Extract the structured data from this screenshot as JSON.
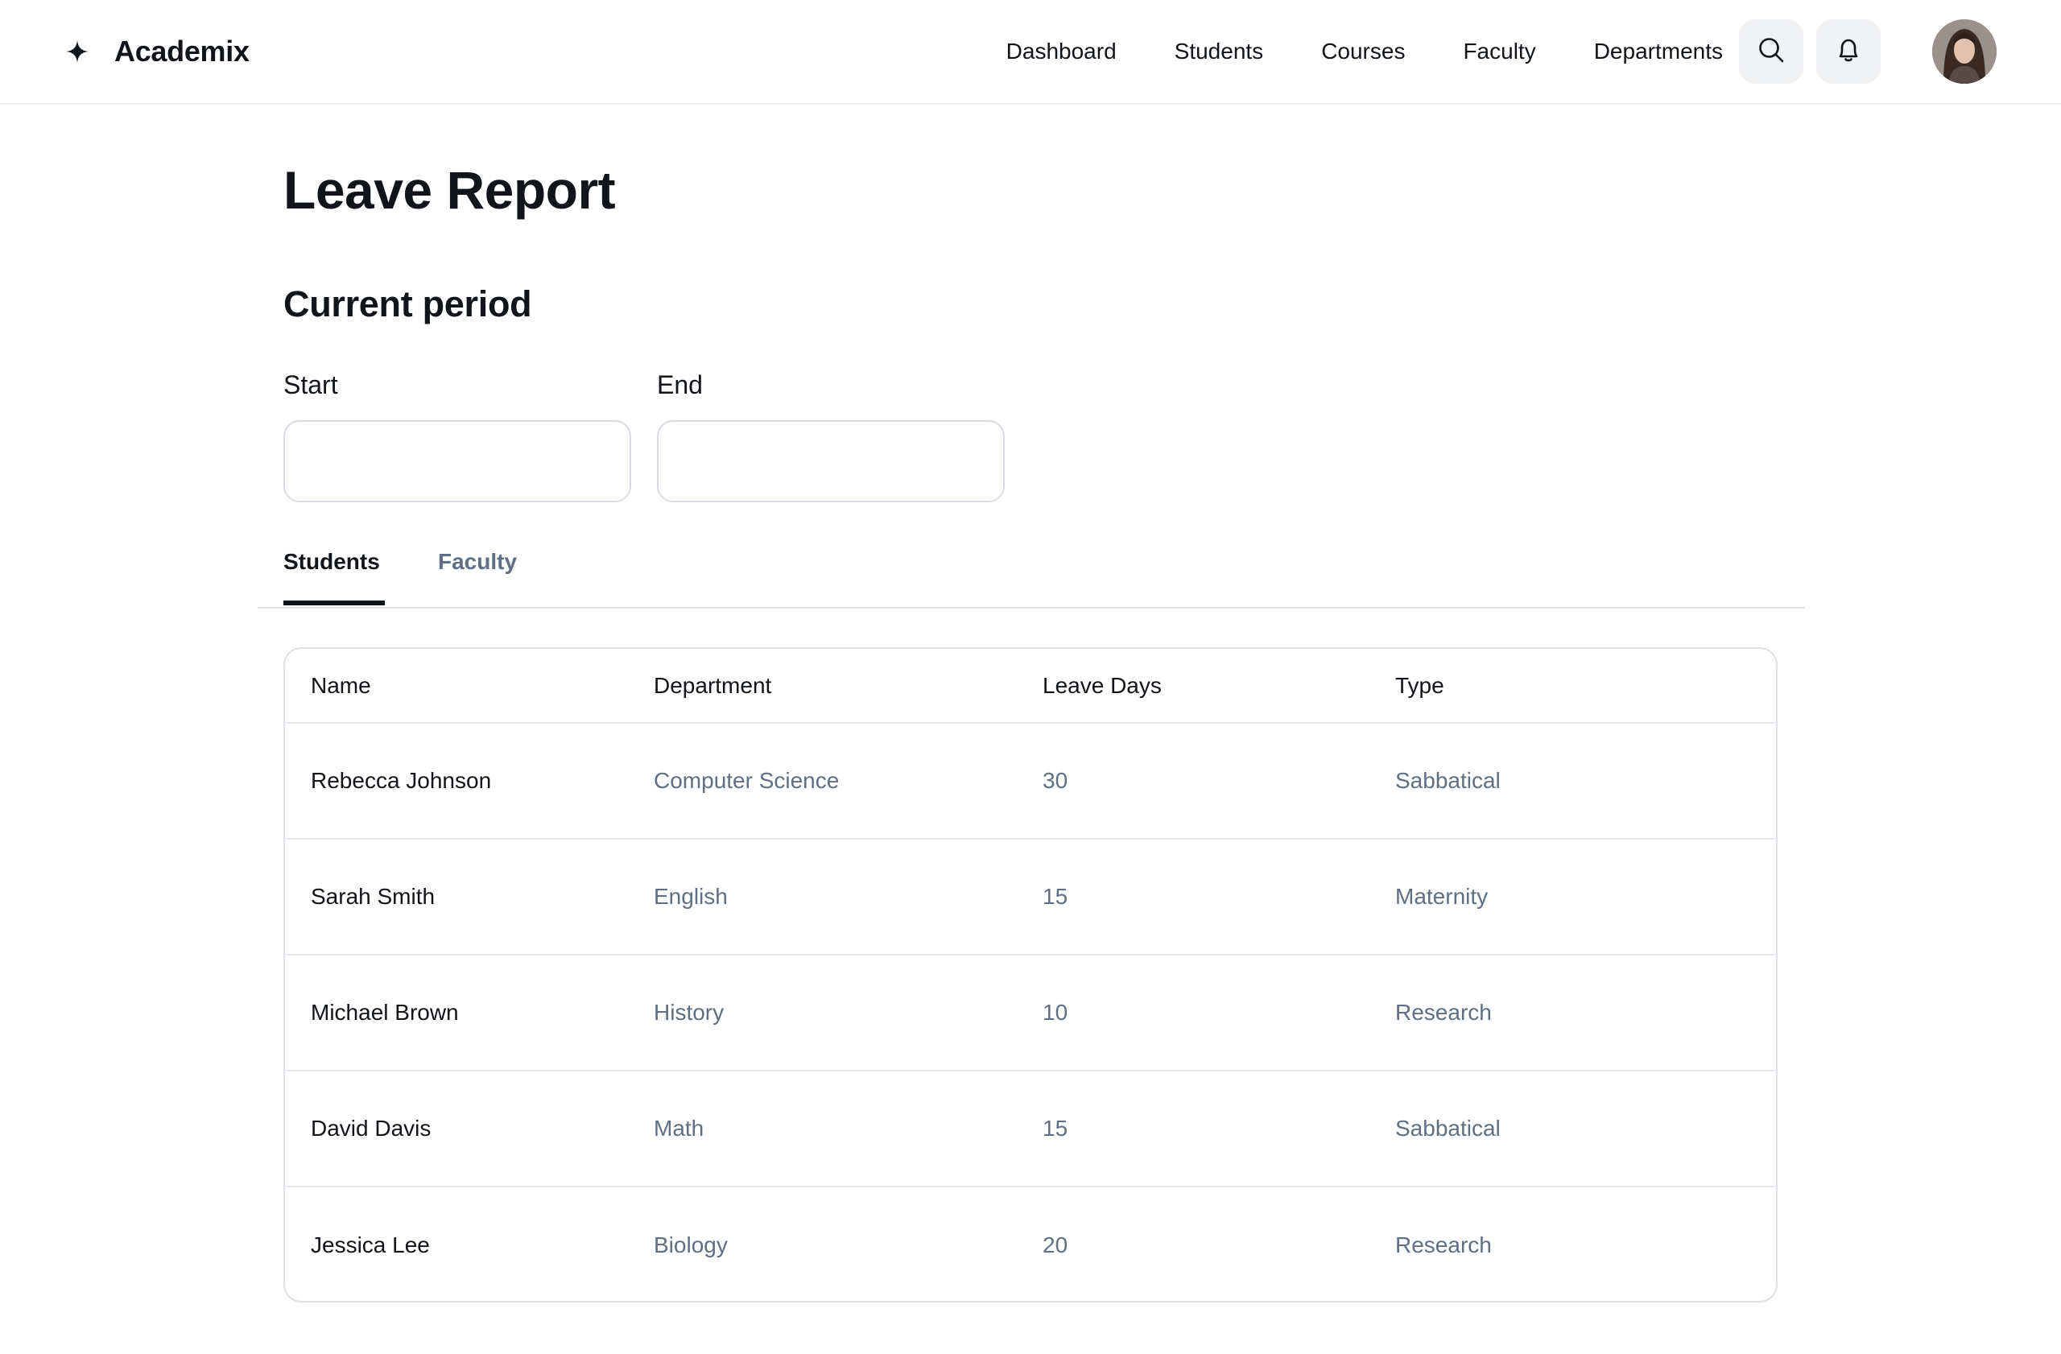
{
  "app": {
    "name": "Academix"
  },
  "nav": {
    "items": [
      {
        "label": "Dashboard"
      },
      {
        "label": "Students"
      },
      {
        "label": "Courses"
      },
      {
        "label": "Faculty"
      },
      {
        "label": "Departments"
      }
    ]
  },
  "icons": {
    "brand": "sparkle-icon",
    "search": "search-icon",
    "notifications": "bell-icon",
    "avatar": "user-avatar"
  },
  "page": {
    "title": "Leave Report",
    "section_title": "Current period"
  },
  "period": {
    "start": {
      "label": "Start",
      "value": "",
      "placeholder": ""
    },
    "end": {
      "label": "End",
      "value": "",
      "placeholder": ""
    }
  },
  "tabs": [
    {
      "label": "Students",
      "active": true
    },
    {
      "label": "Faculty",
      "active": false
    }
  ],
  "table": {
    "columns": [
      "Name",
      "Department",
      "Leave Days",
      "Type"
    ],
    "rows": [
      {
        "name": "Rebecca Johnson",
        "department": "Computer Science",
        "leave_days": "30",
        "type": "Sabbatical"
      },
      {
        "name": "Sarah Smith",
        "department": "English",
        "leave_days": "15",
        "type": "Maternity"
      },
      {
        "name": "Michael Brown",
        "department": "History",
        "leave_days": "10",
        "type": "Research"
      },
      {
        "name": "David Davis",
        "department": "Math",
        "leave_days": "15",
        "type": "Sabbatical"
      },
      {
        "name": "Jessica Lee",
        "department": "Biology",
        "leave_days": "20",
        "type": "Research"
      }
    ]
  },
  "colors": {
    "text": "#111418",
    "muted": "#5f6f84",
    "border": "#dde0e5",
    "icon_bg": "#f1f2f4"
  }
}
